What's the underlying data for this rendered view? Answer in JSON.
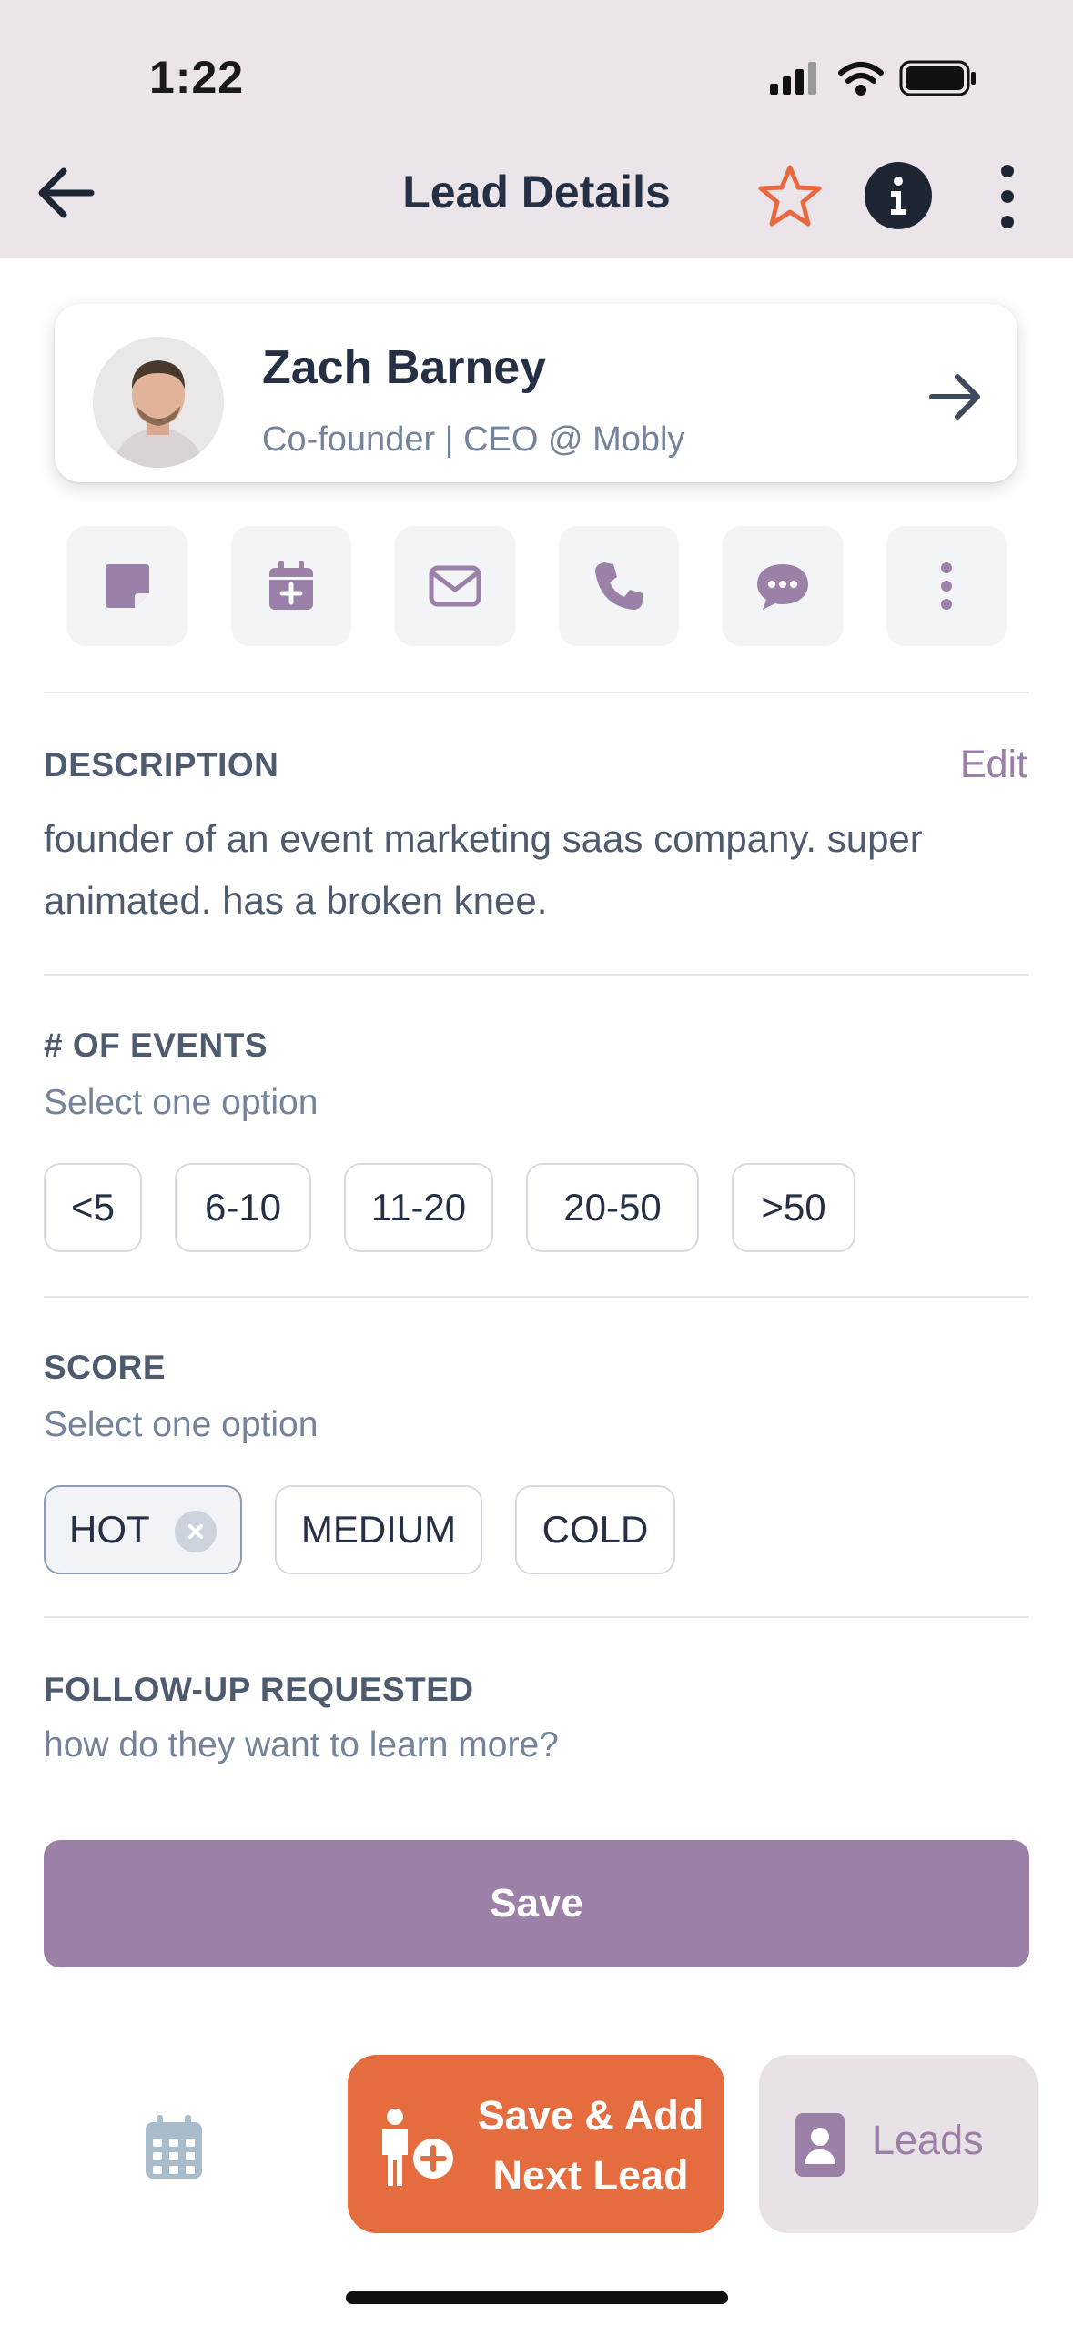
{
  "status_bar": {
    "time": "1:22"
  },
  "header": {
    "title": "Lead Details"
  },
  "contact": {
    "name": "Zach Barney",
    "subtitle": "Co-founder | CEO @ Mobly"
  },
  "actions": [
    "note-icon",
    "calendar-add-icon",
    "mail-icon",
    "phone-icon",
    "chat-icon",
    "more-icon"
  ],
  "description": {
    "title": "DESCRIPTION",
    "edit_label": "Edit",
    "text": "founder of an event marketing saas company. super animated. has a broken knee."
  },
  "events": {
    "title": "# OF EVENTS",
    "subtitle": "Select one option",
    "options": [
      "<5",
      "6-10",
      "11-20",
      "20-50",
      ">50"
    ]
  },
  "score": {
    "title": "SCORE",
    "subtitle": "Select one option",
    "options": [
      "HOT",
      "MEDIUM",
      "COLD"
    ],
    "selected": "HOT"
  },
  "follow_up": {
    "title": "FOLLOW-UP REQUESTED",
    "subtitle": "how do they want to learn more?"
  },
  "save_label": "Save",
  "bottom_nav": {
    "save_add_line1": "Save & Add",
    "save_add_line2": "Next Lead",
    "leads_label": "Leads"
  },
  "colors": {
    "header_bg": "#ebe4e8",
    "accent_purple": "#9b80a8",
    "accent_orange": "#e46c3f",
    "star_orange": "#e8683f"
  }
}
